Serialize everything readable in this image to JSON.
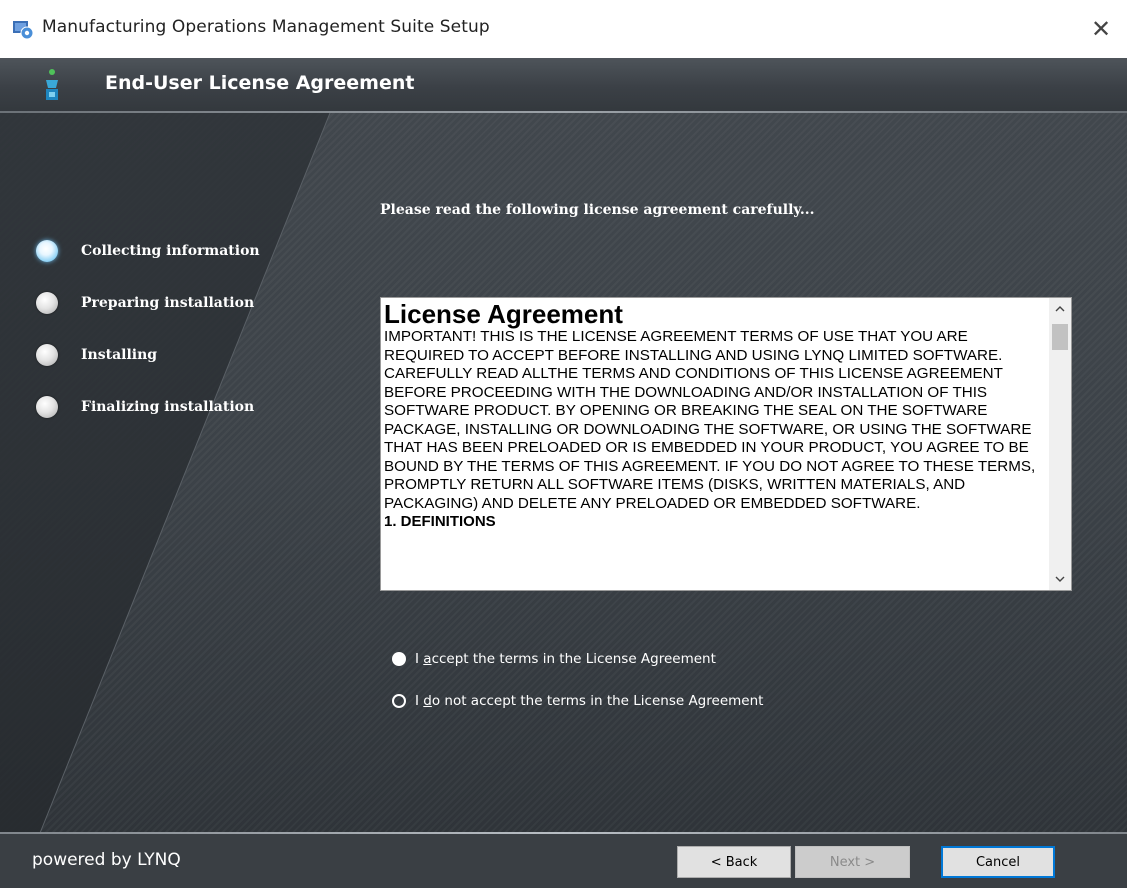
{
  "window": {
    "title": "Manufacturing Operations Management Suite Setup",
    "close_symbol": "✕"
  },
  "header": {
    "title": "End-User License Agreement"
  },
  "steps": [
    {
      "label": "Collecting information",
      "state": "active"
    },
    {
      "label": "Preparing installation",
      "state": "pending"
    },
    {
      "label": "Installing",
      "state": "pending"
    },
    {
      "label": "Finalizing installation",
      "state": "pending"
    }
  ],
  "main": {
    "instruction": "Please read the following license agreement carefully...",
    "license": {
      "heading": "License Agreement",
      "body": "IMPORTANT! THIS IS THE LICENSE AGREEMENT TERMS OF USE THAT YOU ARE REQUIRED TO ACCEPT BEFORE INSTALLING AND USING LYNQ LIMITED SOFTWARE. CAREFULLY READ ALLTHE TERMS AND CONDITIONS OF THIS LICENSE AGREEMENT BEFORE PROCEEDING WITH THE DOWNLOADING AND/OR INSTALLATION OF THIS SOFTWARE PRODUCT. BY OPENING OR BREAKING THE SEAL ON THE SOFTWARE PACKAGE, INSTALLING OR DOWNLOADING THE SOFTWARE, OR USING THE SOFTWARE THAT HAS BEEN PRELOADED OR IS EMBEDDED IN YOUR PRODUCT, YOU AGREE TO BE BOUND BY THE TERMS OF THIS AGREEMENT. IF YOU DO NOT AGREE TO THESE TERMS, PROMPTLY RETURN ALL SOFTWARE ITEMS (DISKS, WRITTEN MATERIALS, AND PACKAGING) AND DELETE ANY PRELOADED OR EMBEDDED SOFTWARE.",
      "next_section": "1.    DEFINITIONS"
    },
    "options": {
      "accept": {
        "prefix": "I ",
        "mnemonic": "a",
        "rest": "ccept the terms in the License Agreement",
        "selected": true
      },
      "decline": {
        "prefix": "I ",
        "mnemonic": "d",
        "rest": "o not accept the terms in the License Agreement",
        "selected": false
      }
    }
  },
  "footer": {
    "powered_by": "powered by LYNQ",
    "back_label": "< Back",
    "next_label": "Next >",
    "cancel_label": "Cancel"
  },
  "icons": {
    "app": "setup-app-icon",
    "header": "installer-figure-icon",
    "close": "close-icon",
    "scroll_up": "chevron-up-icon",
    "scroll_down": "chevron-down-icon"
  },
  "colors": {
    "active_step": "#5db3e3",
    "background": "#3a3f44",
    "cancel_focus": "#0078d7"
  }
}
